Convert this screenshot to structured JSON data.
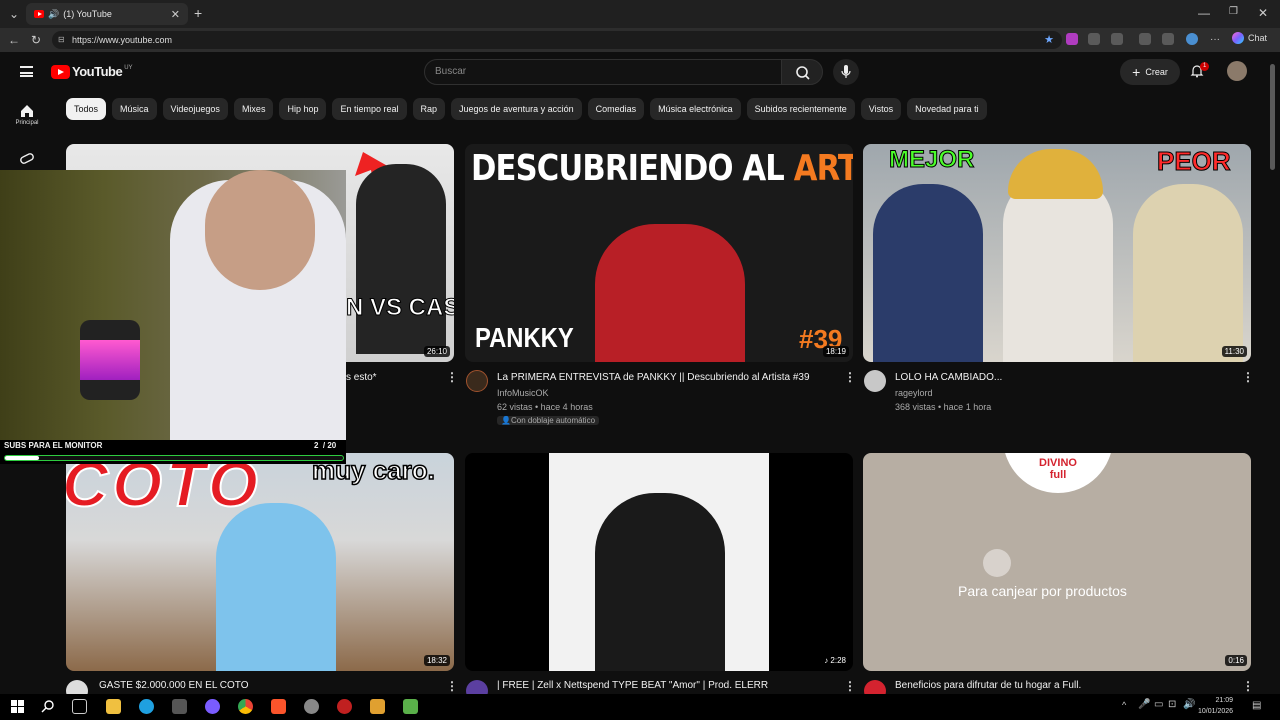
{
  "browser": {
    "tab_title": "(1) YouTube",
    "url": "https://www.youtube.com",
    "chat_label": "Chat"
  },
  "header": {
    "logo_text": "YouTube",
    "logo_country": "UY",
    "search_placeholder": "Buscar",
    "create_label": "Crear",
    "notification_count": "1"
  },
  "guide": {
    "home_label": "Principal"
  },
  "chips": [
    "Todos",
    "Música",
    "Videojuegos",
    "Mixes",
    "Hip hop",
    "En tiempo real",
    "Rap",
    "Juegos de aventura y acción",
    "Comedias",
    "Música electrónica",
    "Subidos recientemente",
    "Vistos",
    "Novedad para ti"
  ],
  "videos": [
    {
      "title": "s esto*",
      "duration": "26:10",
      "thumb_text": "N VS CAS"
    },
    {
      "title": "La PRIMERA ENTREVISTA de PANKKY || Descubriendo al Artista #39",
      "channel": "InfoMusicOK",
      "stats": "62 vistas • hace 4 horas",
      "badge": "Con doblaje automático",
      "duration": "18:19",
      "thumb_text_a": "DESCUBRIENDO AL ",
      "thumb_text_b": "ARTISTA",
      "thumb_name": "PANKKY",
      "thumb_num": "#39"
    },
    {
      "title": "LOLO HA CAMBIADO...",
      "channel": "rageylord",
      "stats": "368 vistas • hace 1 hora",
      "duration": "11:30",
      "thumb_left": "MEJOR",
      "thumb_right": "PEOR"
    },
    {
      "title": "GASTE $2.000.000 EN EL COTO",
      "duration": "18:32",
      "thumb_text": "muy caro.",
      "thumb_logo": "COTO"
    },
    {
      "title": "| FREE | Zell x Nettspend TYPE BEAT \"Amor\" | Prod. ELERR",
      "duration": "2:28"
    },
    {
      "title": "Beneficios para difrutar de tu hogar a Full.",
      "duration": "0:16",
      "thumb_brand_a": "DIVINO",
      "thumb_brand_b": "full",
      "thumb_text": "Para canjear por productos"
    }
  ],
  "stream": {
    "goal_label": "SUBS PARA EL MONITOR",
    "goal_count": "2  / 20",
    "goal_progress": 0.1
  },
  "clock": {
    "time": "21:09",
    "date": "10/01/2026"
  },
  "colors": {
    "accent": "#ff0000",
    "background": "#0f0f0f",
    "artist_orange": "#f47a20",
    "goal_border": "#2ecc40"
  }
}
